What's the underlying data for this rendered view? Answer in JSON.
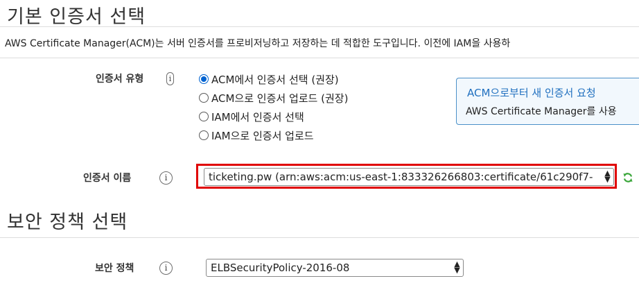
{
  "sections": {
    "cert_section_title": "기본 인증서 선택",
    "security_section_title": "보안 정책 선택"
  },
  "description": "AWS Certificate Manager(ACM)는 서버 인증서를 프로비저닝하고 저장하는 데 적합한 도구입니다. 이전에 IAM을 사용하",
  "cert_type": {
    "label": "인증서 유형",
    "options": [
      {
        "label": "ACM에서 인증서 선택 (권장)",
        "selected": true
      },
      {
        "label": "ACM으로 인증서 업로드 (권장)",
        "selected": false
      },
      {
        "label": "IAM에서 인증서 선택",
        "selected": false
      },
      {
        "label": "IAM으로 인증서 업로드",
        "selected": false
      }
    ]
  },
  "callout": {
    "link": "ACM으로부터 새 인증서 요청",
    "text": "AWS Certificate Manager를 사용"
  },
  "cert_name": {
    "label": "인증서 이름",
    "value": "ticketing.pw (arn:aws:acm:us-east-1:833326266803:certificate/61c290f7-"
  },
  "security_policy": {
    "label": "보안 정책",
    "value": "ELBSecurityPolicy-2016-08"
  },
  "icons": {
    "info": "i",
    "select_arrow": "▲▼",
    "refresh": "refresh-icon"
  },
  "colors": {
    "accent": "#0063d1",
    "link": "#1f6fbf",
    "highlight": "#e00000",
    "refresh": "#3aa63a"
  }
}
